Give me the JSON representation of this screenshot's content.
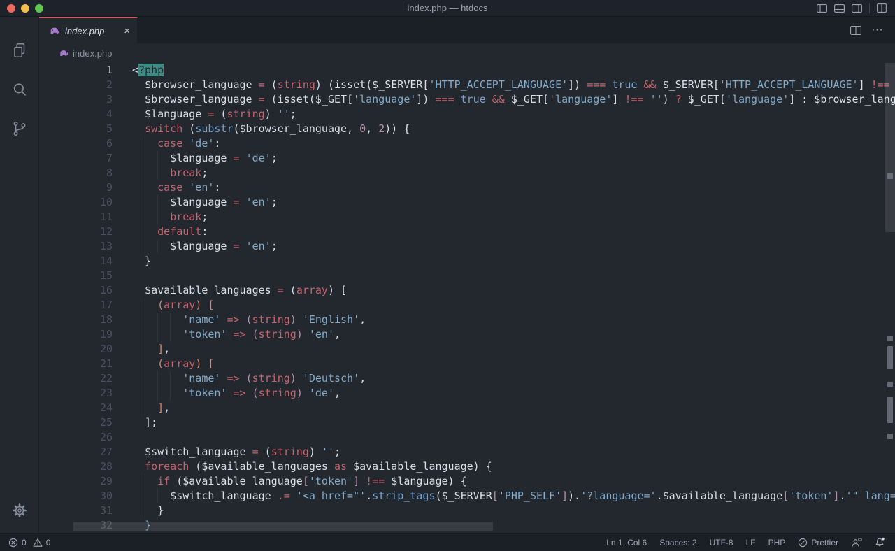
{
  "window": {
    "title": "index.php — htdocs"
  },
  "tab": {
    "label": "index.php",
    "close_label": "×",
    "preview": true
  },
  "breadcrumb": {
    "file": "index.php"
  },
  "palette": {
    "editor_bg": "#23272e",
    "chrome_bg": "#1b1f26",
    "titlebar_bg": "#1e222b",
    "tab_accent": "#cb5b66",
    "default_text": "#d8dee9",
    "keyword_red": "#c5646e",
    "string_blue": "#81aac9",
    "function_blue": "#74a3cd",
    "number_purple": "#b48ead",
    "bracket_orange": "#d08770",
    "selection_bg": "#3c8d83",
    "line_number": "#4a5261",
    "status_text": "#a0a8b7",
    "php_icon_purple": "#a87bc9",
    "traffic_red": "#ec6a5e",
    "traffic_yellow": "#f4bf4f",
    "traffic_green": "#61c554"
  },
  "icons": [
    "close-traffic",
    "minimize-traffic",
    "zoom-traffic",
    "layout-sidebar-left-icon",
    "layout-panel-icon",
    "layout-sidebar-right-icon",
    "customize-layout-icon",
    "php-elephant-icon",
    "close-icon",
    "split-editor-icon",
    "more-actions-icon",
    "explorer-files-icon",
    "search-icon",
    "source-control-icon",
    "settings-gear-icon",
    "errors-icon",
    "warnings-icon",
    "prettier-icon",
    "feedback-icon",
    "bell-icon"
  ],
  "status": {
    "errors": "0",
    "warnings": "0",
    "line_col": "Ln 1, Col 6",
    "indent": "Spaces: 2",
    "encoding": "UTF-8",
    "eol": "LF",
    "language": "PHP",
    "formatter": "Prettier"
  },
  "editor": {
    "active_line": 1,
    "selection_text": "?php",
    "lines": [
      {
        "n": 1,
        "g": 0,
        "t": [
          [
            "w",
            "<"
          ],
          [
            "sel",
            "?php"
          ]
        ]
      },
      {
        "n": 2,
        "g": 0,
        "t": [
          [
            "w",
            "  $browser_language "
          ],
          [
            "r",
            "="
          ],
          [
            "w",
            " ("
          ],
          [
            "r",
            "string"
          ],
          [
            "w",
            ") (isset($_SERVER["
          ],
          [
            "s",
            "'HTTP_ACCEPT_LANGUAGE'"
          ],
          [
            "w",
            "]) "
          ],
          [
            "r",
            "==="
          ],
          [
            "w",
            " "
          ],
          [
            "bool",
            "true"
          ],
          [
            "w",
            " "
          ],
          [
            "r",
            "&&"
          ],
          [
            "w",
            " $_SERVER["
          ],
          [
            "s",
            "'HTTP_ACCEPT_LANGUAGE'"
          ],
          [
            "w",
            "] "
          ],
          [
            "r",
            "!=="
          ],
          [
            "w",
            " "
          ],
          [
            "s",
            "''"
          ],
          [
            "w",
            ") "
          ],
          [
            "r",
            "?"
          ]
        ]
      },
      {
        "n": 3,
        "g": 0,
        "t": [
          [
            "w",
            "  $browser_language "
          ],
          [
            "r",
            "="
          ],
          [
            "w",
            " (isset($_GET["
          ],
          [
            "s",
            "'language'"
          ],
          [
            "w",
            "]) "
          ],
          [
            "r",
            "==="
          ],
          [
            "w",
            " "
          ],
          [
            "bool",
            "true"
          ],
          [
            "w",
            " "
          ],
          [
            "r",
            "&&"
          ],
          [
            "w",
            " $_GET["
          ],
          [
            "s",
            "'language'"
          ],
          [
            "w",
            "] "
          ],
          [
            "r",
            "!=="
          ],
          [
            "w",
            " "
          ],
          [
            "s",
            "''"
          ],
          [
            "w",
            ") "
          ],
          [
            "r",
            "?"
          ],
          [
            "w",
            " $_GET["
          ],
          [
            "s",
            "'language'"
          ],
          [
            "w",
            "] : $browser_language;"
          ]
        ]
      },
      {
        "n": 4,
        "g": 0,
        "t": [
          [
            "w",
            "  $language "
          ],
          [
            "r",
            "="
          ],
          [
            "w",
            " ("
          ],
          [
            "r",
            "string"
          ],
          [
            "w",
            ") "
          ],
          [
            "s",
            "''"
          ],
          [
            "w",
            ";"
          ]
        ]
      },
      {
        "n": 5,
        "g": 0,
        "t": [
          [
            "w",
            "  "
          ],
          [
            "r",
            "switch"
          ],
          [
            "w",
            " ("
          ],
          [
            "fn",
            "substr"
          ],
          [
            "w",
            "($browser_language, "
          ],
          [
            "num",
            "0"
          ],
          [
            "w",
            ", "
          ],
          [
            "num",
            "2"
          ],
          [
            "w",
            ")) {"
          ]
        ]
      },
      {
        "n": 6,
        "g": 1,
        "t": [
          [
            "w",
            "    "
          ],
          [
            "r",
            "case"
          ],
          [
            "w",
            " "
          ],
          [
            "s",
            "'de'"
          ],
          [
            "w",
            ":"
          ]
        ]
      },
      {
        "n": 7,
        "g": 2,
        "t": [
          [
            "w",
            "      $language "
          ],
          [
            "r",
            "="
          ],
          [
            "w",
            " "
          ],
          [
            "s",
            "'de'"
          ],
          [
            "w",
            ";"
          ]
        ]
      },
      {
        "n": 8,
        "g": 2,
        "t": [
          [
            "w",
            "      "
          ],
          [
            "r",
            "break"
          ],
          [
            "w",
            ";"
          ]
        ]
      },
      {
        "n": 9,
        "g": 1,
        "t": [
          [
            "w",
            "    "
          ],
          [
            "r",
            "case"
          ],
          [
            "w",
            " "
          ],
          [
            "s",
            "'en'"
          ],
          [
            "w",
            ":"
          ]
        ]
      },
      {
        "n": 10,
        "g": 2,
        "t": [
          [
            "w",
            "      $language "
          ],
          [
            "r",
            "="
          ],
          [
            "w",
            " "
          ],
          [
            "s",
            "'en'"
          ],
          [
            "w",
            ";"
          ]
        ]
      },
      {
        "n": 11,
        "g": 2,
        "t": [
          [
            "w",
            "      "
          ],
          [
            "r",
            "break"
          ],
          [
            "w",
            ";"
          ]
        ]
      },
      {
        "n": 12,
        "g": 1,
        "t": [
          [
            "w",
            "    "
          ],
          [
            "r",
            "default"
          ],
          [
            "w",
            ":"
          ]
        ]
      },
      {
        "n": 13,
        "g": 2,
        "t": [
          [
            "w",
            "      $language "
          ],
          [
            "r",
            "="
          ],
          [
            "w",
            " "
          ],
          [
            "s",
            "'en'"
          ],
          [
            "w",
            ";"
          ]
        ]
      },
      {
        "n": 14,
        "g": 0,
        "t": [
          [
            "w",
            "  }"
          ]
        ]
      },
      {
        "n": 15,
        "g": 0,
        "t": []
      },
      {
        "n": 16,
        "g": 0,
        "t": [
          [
            "w",
            "  $available_languages "
          ],
          [
            "r",
            "="
          ],
          [
            "w",
            " ("
          ],
          [
            "r",
            "array"
          ],
          [
            "w",
            ") ["
          ]
        ]
      },
      {
        "n": 17,
        "g": 1,
        "t": [
          [
            "w",
            "    "
          ],
          [
            "br2",
            "("
          ],
          [
            "r",
            "array"
          ],
          [
            "br2",
            ")"
          ],
          [
            "w",
            " "
          ],
          [
            "br2",
            "["
          ]
        ]
      },
      {
        "n": 18,
        "g": 3,
        "t": [
          [
            "w",
            "        "
          ],
          [
            "s",
            "'name'"
          ],
          [
            "w",
            " "
          ],
          [
            "r",
            "=>"
          ],
          [
            "w",
            " "
          ],
          [
            "br3",
            "("
          ],
          [
            "r",
            "string"
          ],
          [
            "br3",
            ")"
          ],
          [
            "w",
            " "
          ],
          [
            "s",
            "'English'"
          ],
          [
            "w",
            ","
          ]
        ]
      },
      {
        "n": 19,
        "g": 3,
        "t": [
          [
            "w",
            "        "
          ],
          [
            "s",
            "'token'"
          ],
          [
            "w",
            " "
          ],
          [
            "r",
            "=>"
          ],
          [
            "w",
            " "
          ],
          [
            "br3",
            "("
          ],
          [
            "r",
            "string"
          ],
          [
            "br3",
            ")"
          ],
          [
            "w",
            " "
          ],
          [
            "s",
            "'en'"
          ],
          [
            "w",
            ","
          ]
        ]
      },
      {
        "n": 20,
        "g": 1,
        "t": [
          [
            "w",
            "    "
          ],
          [
            "br2",
            "]"
          ],
          [
            "w",
            ","
          ]
        ]
      },
      {
        "n": 21,
        "g": 1,
        "t": [
          [
            "w",
            "    "
          ],
          [
            "br2",
            "("
          ],
          [
            "r",
            "array"
          ],
          [
            "br2",
            ")"
          ],
          [
            "w",
            " "
          ],
          [
            "br2",
            "["
          ]
        ]
      },
      {
        "n": 22,
        "g": 3,
        "t": [
          [
            "w",
            "        "
          ],
          [
            "s",
            "'name'"
          ],
          [
            "w",
            " "
          ],
          [
            "r",
            "=>"
          ],
          [
            "w",
            " "
          ],
          [
            "br3",
            "("
          ],
          [
            "r",
            "string"
          ],
          [
            "br3",
            ")"
          ],
          [
            "w",
            " "
          ],
          [
            "s",
            "'Deutsch'"
          ],
          [
            "w",
            ","
          ]
        ]
      },
      {
        "n": 23,
        "g": 3,
        "t": [
          [
            "w",
            "        "
          ],
          [
            "s",
            "'token'"
          ],
          [
            "w",
            " "
          ],
          [
            "r",
            "=>"
          ],
          [
            "w",
            " "
          ],
          [
            "br3",
            "("
          ],
          [
            "r",
            "string"
          ],
          [
            "br3",
            ")"
          ],
          [
            "w",
            " "
          ],
          [
            "s",
            "'de'"
          ],
          [
            "w",
            ","
          ]
        ]
      },
      {
        "n": 24,
        "g": 1,
        "t": [
          [
            "w",
            "    "
          ],
          [
            "br2",
            "]"
          ],
          [
            "w",
            ","
          ]
        ]
      },
      {
        "n": 25,
        "g": 0,
        "t": [
          [
            "w",
            "  ];"
          ]
        ]
      },
      {
        "n": 26,
        "g": 0,
        "t": []
      },
      {
        "n": 27,
        "g": 0,
        "t": [
          [
            "w",
            "  $switch_language "
          ],
          [
            "r",
            "="
          ],
          [
            "w",
            " ("
          ],
          [
            "r",
            "string"
          ],
          [
            "w",
            ") "
          ],
          [
            "s",
            "''"
          ],
          [
            "w",
            ";"
          ]
        ]
      },
      {
        "n": 28,
        "g": 0,
        "t": [
          [
            "w",
            "  "
          ],
          [
            "r",
            "foreach"
          ],
          [
            "w",
            " ($available_languages "
          ],
          [
            "r",
            "as"
          ],
          [
            "w",
            " $available_language) {"
          ]
        ]
      },
      {
        "n": 29,
        "g": 1,
        "t": [
          [
            "w",
            "    "
          ],
          [
            "r",
            "if"
          ],
          [
            "w",
            " ($available_language"
          ],
          [
            "br3",
            "["
          ],
          [
            "s",
            "'token'"
          ],
          [
            "br3",
            "]"
          ],
          [
            "w",
            " "
          ],
          [
            "r",
            "!=="
          ],
          [
            "w",
            " $language) {"
          ]
        ]
      },
      {
        "n": 30,
        "g": 2,
        "t": [
          [
            "w",
            "      $switch_language "
          ],
          [
            "r",
            ".="
          ],
          [
            "w",
            " "
          ],
          [
            "s",
            "'<a href=\"'"
          ],
          [
            "w",
            "."
          ],
          [
            "fn",
            "strip_tags"
          ],
          [
            "w",
            "($_SERVER"
          ],
          [
            "br3",
            "["
          ],
          [
            "s",
            "'PHP_SELF'"
          ],
          [
            "br3",
            "]"
          ],
          [
            "w",
            ")."
          ],
          [
            "s",
            "'?language='"
          ],
          [
            "w",
            ".$available_language"
          ],
          [
            "br3",
            "["
          ],
          [
            "s",
            "'token'"
          ],
          [
            "br3",
            "]"
          ],
          [
            "w",
            "."
          ],
          [
            "s",
            "'\" lang=\"'"
          ],
          [
            "w",
            ".$"
          ]
        ]
      },
      {
        "n": 31,
        "g": 1,
        "t": [
          [
            "w",
            "    }"
          ]
        ]
      },
      {
        "n": 32,
        "g": 0,
        "t": [
          [
            "w",
            "  "
          ],
          [
            "bool",
            "}"
          ]
        ]
      }
    ]
  }
}
